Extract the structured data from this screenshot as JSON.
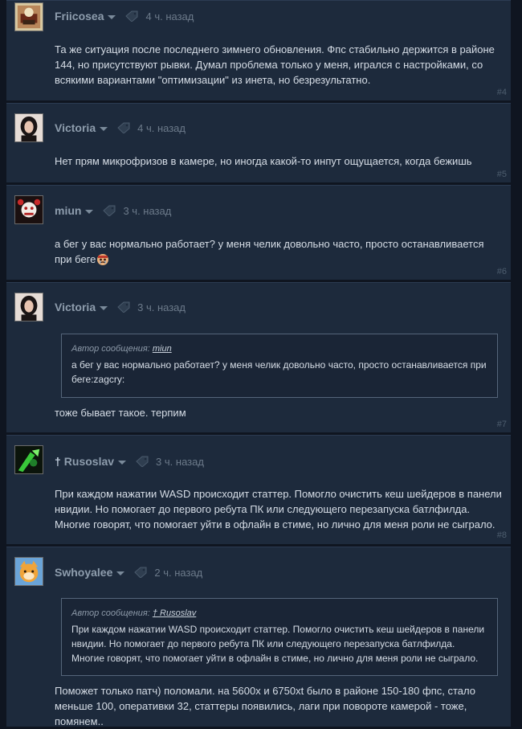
{
  "thread": {
    "posts": [
      {
        "author": "Friicosea",
        "time": "4 ч. назад",
        "lines": [
          "Та же ситуация после последнего зимнего обновления. Фпс стабильно держится в районе",
          "144, но присутствуют рывки. Думал проблема только у меня, игрался с настройками, со",
          "всякими вариантами \"оптимизации\" из инета, но безрезультатно."
        ],
        "number": "#4"
      },
      {
        "author": "Victoria",
        "time": "4 ч. назад",
        "lines": [
          "Нет прям микрофризов в камере, но иногда какой-то инпут ощущается, когда бежишь"
        ],
        "number": "#5"
      },
      {
        "author": "miun",
        "time": "3 ч. назад",
        "lines": [
          "а бег у вас нормально работает? у меня челик довольно часто, просто останавливается",
          "при беге"
        ],
        "emote": "zagcry",
        "number": "#6"
      },
      {
        "author": "Victoria",
        "time": "3 ч. назад",
        "quote": {
          "label": "Автор сообщения:",
          "author": "miun",
          "lines": [
            "а бег у вас нормально работает? у меня челик довольно часто, просто останавливается при",
            "беге:zagcry:"
          ]
        },
        "lines": [
          "тоже бывает такое. терпим"
        ],
        "number": "#7"
      },
      {
        "author_prefix": "†",
        "author": "Rusoslav",
        "time": "3 ч. назад",
        "lines": [
          "При каждом нажатии WASD происходит статтер. Помогло очистить кеш шейдеров в панели",
          "нвидии. Но помогает до первого ребута ПК или следующего перезапуска батлфилда.",
          "Многие говорят, что помогает уйти в офлайн в стиме, но лично для меня роли не сыграло."
        ],
        "number": "#8"
      },
      {
        "author": "Swhoyalee",
        "time": "2 ч. назад",
        "quote": {
          "label": "Автор сообщения:",
          "author": "† Rusoslav",
          "lines": [
            "При каждом нажатии WASD происходит статтер. Помогло очистить кеш шейдеров в панели",
            "нвидии. Но помогает до первого ребута ПК или следующего перезапуска батлфилда.",
            "Многие говорят, что помогает уйти в офлайн в стиме, но лично для меня роли не сыграло."
          ]
        },
        "lines": [
          "Поможет только патч) поломали. на 5600x и 6750xt было в районе 150-180 фпс, стало",
          "меньше 100, оперативки 32, статтеры появились, лаги при повороте камерой - тоже,",
          "помянем.."
        ]
      }
    ]
  },
  "icons": {
    "caret": "chevron-down-icon",
    "tag": "tag-icon",
    "emote": "zagcry-emote-icon"
  },
  "colors": {
    "page_bg": "#0f1520",
    "post_bg": "#1d2a3c",
    "author": "#8e9dad",
    "text": "#d6dde6",
    "muted": "#6c7a8a",
    "post_number": "#4e5e6f"
  }
}
